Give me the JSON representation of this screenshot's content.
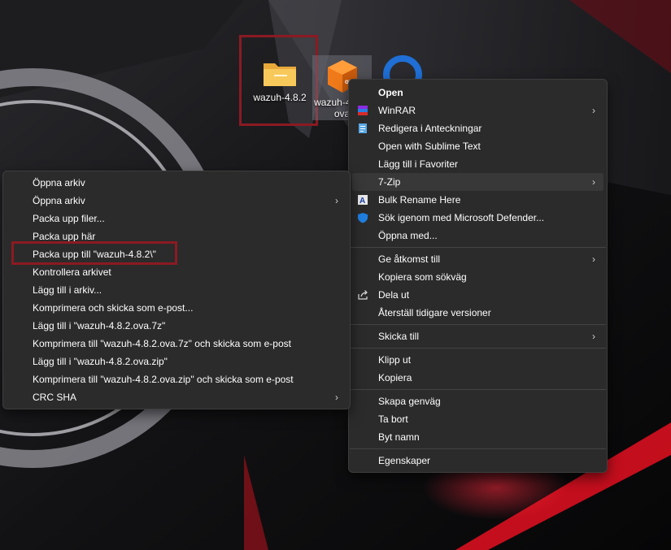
{
  "desktop": {
    "icons": [
      {
        "label": "wazuh-4.8.2"
      },
      {
        "label": "wazuh-4.8.2.ova"
      }
    ]
  },
  "context_menu": {
    "items": [
      {
        "label": "Open",
        "bold": true
      },
      {
        "label": "WinRAR",
        "submenu": true
      },
      {
        "label": "Redigera i Anteckningar"
      },
      {
        "label": "Open with Sublime Text"
      },
      {
        "label": "Lägg till i Favoriter"
      },
      {
        "label": "7-Zip",
        "submenu": true,
        "highlighted": true
      },
      {
        "label": "Bulk Rename Here"
      },
      {
        "label": "Sök igenom med Microsoft Defender..."
      },
      {
        "label": "Öppna med..."
      },
      {
        "label": "Ge åtkomst till",
        "submenu": true
      },
      {
        "label": "Kopiera som sökväg"
      },
      {
        "label": "Dela ut"
      },
      {
        "label": "Återställ tidigare versioner"
      },
      {
        "label": "Skicka till",
        "submenu": true
      },
      {
        "label": "Klipp ut"
      },
      {
        "label": "Kopiera"
      },
      {
        "label": "Skapa genväg"
      },
      {
        "label": "Ta bort"
      },
      {
        "label": "Byt namn"
      },
      {
        "label": "Egenskaper"
      }
    ],
    "arrow": "›"
  },
  "zip_submenu": {
    "items": [
      {
        "label": "Öppna arkiv"
      },
      {
        "label": "Öppna arkiv",
        "submenu": true
      },
      {
        "label": "Packa upp filer..."
      },
      {
        "label": "Packa upp här"
      },
      {
        "label": "Packa upp till \"wazuh-4.8.2\\\"",
        "highlighted_box": true
      },
      {
        "label": "Kontrollera arkivet"
      },
      {
        "label": "Lägg till i arkiv..."
      },
      {
        "label": "Komprimera och skicka som e-post..."
      },
      {
        "label": "Lägg till i \"wazuh-4.8.2.ova.7z\""
      },
      {
        "label": "Komprimera till \"wazuh-4.8.2.ova.7z\" och skicka som e-post"
      },
      {
        "label": "Lägg till i \"wazuh-4.8.2.ova.zip\""
      },
      {
        "label": "Komprimera till \"wazuh-4.8.2.ova.zip\" och skicka som e-post"
      },
      {
        "label": "CRC SHA",
        "submenu": true
      }
    ]
  },
  "colors": {
    "menu_bg": "#2b2b2b",
    "highlight_frame": "#8b1a22",
    "wallpaper_accent": "#c8102e"
  }
}
